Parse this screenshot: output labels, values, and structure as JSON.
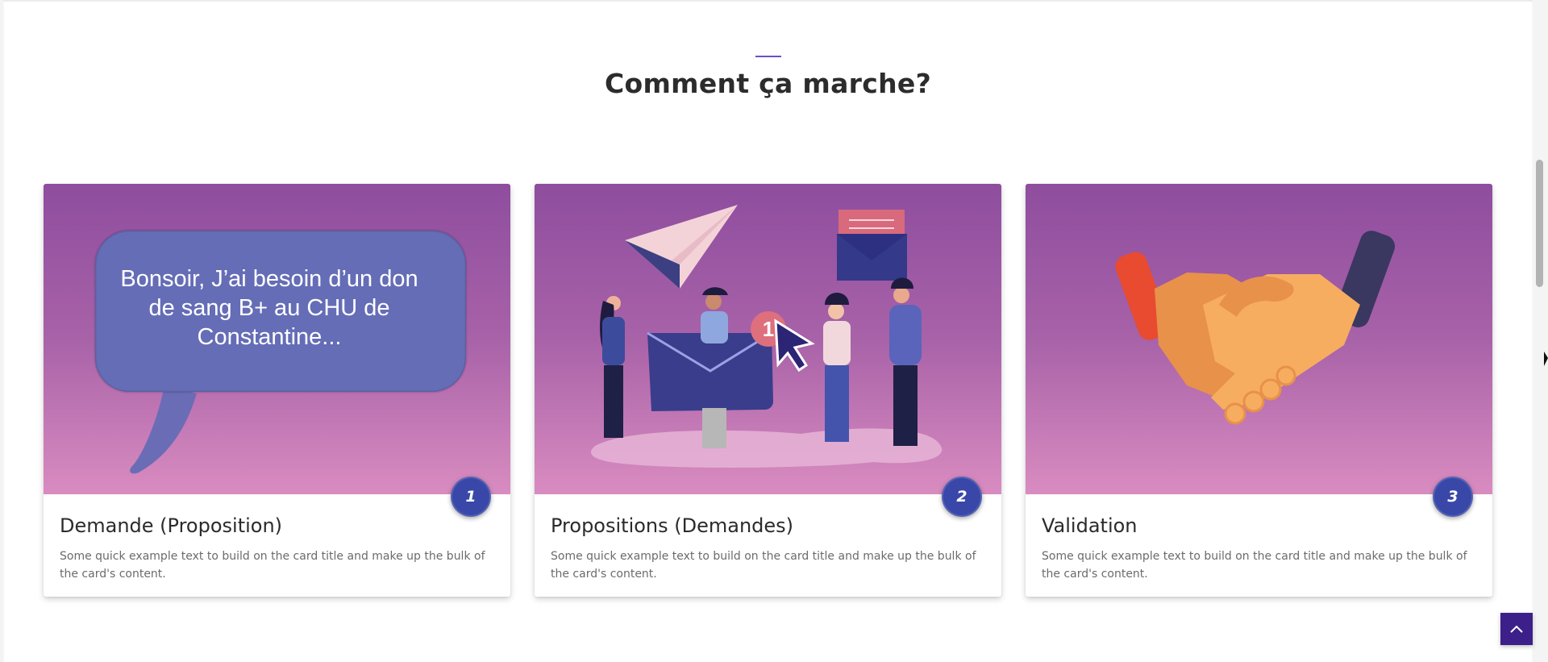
{
  "section": {
    "title": "Comment ça marche?"
  },
  "cards": [
    {
      "step": "1",
      "title": "Demande (Proposition)",
      "text": "Some quick example text to build on the card title and make up the bulk of the card's content.",
      "image_text": "Bonsoir, J’ai besoin d’un don de sang B+ au CHU de Constantine..."
    },
    {
      "step": "2",
      "title": "Propositions (Demandes)",
      "text": "Some quick example text to build on the card title and make up the bulk of the card's content.",
      "image_badge": "1"
    },
    {
      "step": "3",
      "title": "Validation",
      "text": "Some quick example text to build on the card title and make up the bulk of the card's content."
    }
  ],
  "icons": {
    "back_to_top": "chevron-up-icon",
    "card_1_image": "speech-bubble-icon",
    "card_2_image": "envelope-people-icon",
    "card_3_image": "handshake-icon"
  },
  "colors": {
    "accent": "#6a4fd1",
    "badge": "#3948a8",
    "back_to_top": "#3d1f8a",
    "media_top": "#8e4d9e",
    "media_bottom": "#d98cc0"
  }
}
